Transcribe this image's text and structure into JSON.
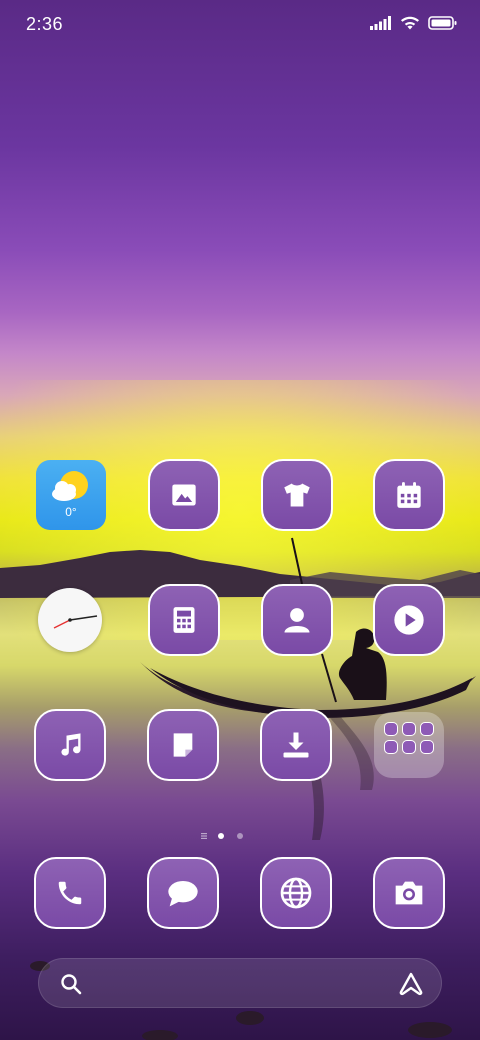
{
  "status_bar": {
    "time": "2:36"
  },
  "weather_widget": {
    "temperature": "0°"
  },
  "colors": {
    "icon_bg": "#7a4aa6",
    "icon_border": "#ffffff",
    "weather_bg": "#3aa0ee"
  },
  "page_indicator": {
    "pages": 2,
    "active_index": 0
  }
}
